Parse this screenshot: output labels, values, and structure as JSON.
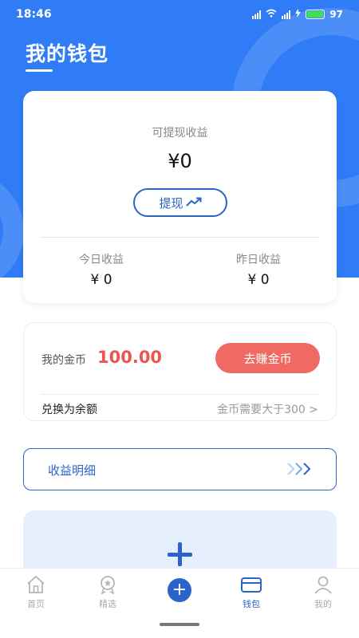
{
  "status_bar": {
    "time": "18:46",
    "battery": "97",
    "battery_level": 0.97
  },
  "header": {
    "title": "我的钱包"
  },
  "earnings": {
    "withdrawable_label": "可提现收益",
    "withdrawable_amount": "¥0",
    "withdraw_button": "提现",
    "today_label": "今日收益",
    "today_value": "¥ 0",
    "yesterday_label": "昨日收益",
    "yesterday_value": "¥ 0"
  },
  "coins": {
    "label": "我的金币",
    "value": "100.00",
    "earn_button": "去赚金币",
    "exchange_label": "兑换为余额",
    "exchange_hint": "金币需要大于300 >"
  },
  "detail": {
    "label": "收益明细"
  },
  "tabs": [
    {
      "label": "首页",
      "icon": "home-icon"
    },
    {
      "label": "精选",
      "icon": "badge-icon"
    },
    {
      "label": "",
      "icon": "plus-circle-icon"
    },
    {
      "label": "钱包",
      "icon": "wallet-icon"
    },
    {
      "label": "我的",
      "icon": "user-icon"
    }
  ],
  "colors": {
    "brand": "#2f7cf6",
    "accent": "#2a63c9",
    "coin": "#ef5350",
    "earn_button": "#f06a64"
  }
}
